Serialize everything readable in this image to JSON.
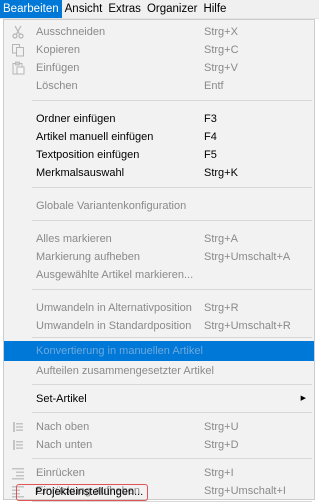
{
  "menubar": {
    "items": [
      {
        "label": "Bearbeiten",
        "active": true
      },
      {
        "label": "Ansicht"
      },
      {
        "label": "Extras"
      },
      {
        "label": "Organizer"
      },
      {
        "label": "Hilfe"
      }
    ]
  },
  "menu": {
    "items": [
      {
        "label": "Ausschneiden",
        "shortcut": "Strg+X",
        "icon": "scissors-icon",
        "disabled": true
      },
      {
        "label": "Kopieren",
        "shortcut": "Strg+C",
        "icon": "copy-icon",
        "disabled": true
      },
      {
        "label": "Einfügen",
        "shortcut": "Strg+V",
        "icon": "paste-icon",
        "disabled": true
      },
      {
        "label": "Löschen",
        "shortcut": "Entf",
        "disabled": true
      },
      {
        "label": "Ordner einfügen",
        "shortcut": "F3"
      },
      {
        "label": "Artikel manuell einfügen",
        "shortcut": "F4"
      },
      {
        "label": "Textposition einfügen",
        "shortcut": "F5"
      },
      {
        "label": "Merkmalsauswahl",
        "shortcut": "Strg+K"
      },
      {
        "label": "Globale Variantenkonfiguration",
        "disabled": true
      },
      {
        "label": "Alles markieren",
        "shortcut": "Strg+A",
        "disabled": true
      },
      {
        "label": "Markierung aufheben",
        "shortcut": "Strg+Umschalt+A",
        "disabled": true
      },
      {
        "label": "Ausgewählte Artikel markieren...",
        "disabled": true
      },
      {
        "label": "Umwandeln in Alternativposition",
        "shortcut": "Strg+R",
        "disabled": true
      },
      {
        "label": "Umwandeln in Standardposition",
        "shortcut": "Strg+Umschalt+R",
        "disabled": true
      },
      {
        "label": "Konvertierung in manuellen Artikel",
        "disabled": true,
        "highlighted": true
      },
      {
        "label": "Aufteilen zusammengesetzter Artikel",
        "disabled": true
      },
      {
        "label": "Set-Artikel",
        "submenu": true
      },
      {
        "label": "Nach oben",
        "shortcut": "Strg+U",
        "icon": "move-up-icon",
        "disabled": true
      },
      {
        "label": "Nach unten",
        "shortcut": "Strg+D",
        "icon": "move-down-icon",
        "disabled": true
      },
      {
        "label": "Einrücken",
        "shortcut": "Strg+I",
        "icon": "indent-icon",
        "disabled": true
      },
      {
        "label": "Einrückung aufheben",
        "shortcut": "Strg+Umschalt+I",
        "icon": "outdent-icon",
        "disabled": true
      },
      {
        "label": "Projekteinstellungen...",
        "focused": true
      }
    ]
  },
  "colors": {
    "accent": "#0078d7",
    "menu_bg": "#f2f2f2",
    "disabled_text": "#8a8a8a",
    "focus_ring": "#e05454"
  }
}
